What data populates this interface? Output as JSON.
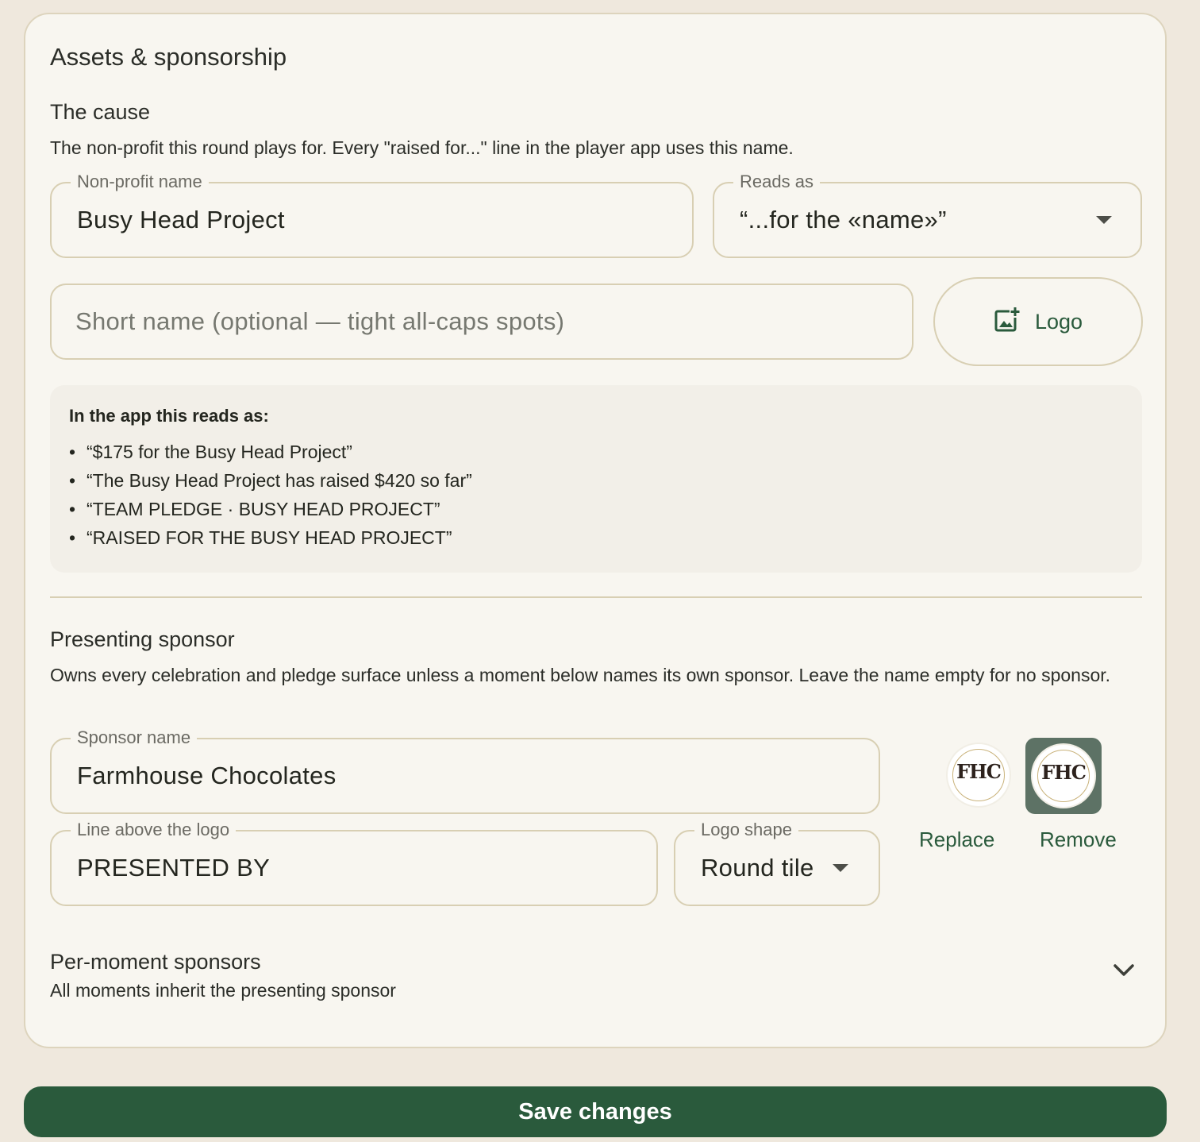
{
  "card": {
    "title": "Assets & sponsorship"
  },
  "cause": {
    "title": "The cause",
    "description": "The non-profit this round plays for. Every \"raised for...\" line in the player app uses this name.",
    "nonprofit_label": "Non-profit name",
    "nonprofit_value": "Busy Head Project",
    "reads_as_label": "Reads as",
    "reads_as_value": "“...for the «name»”",
    "short_name_placeholder": "Short name (optional — tight all-caps spots)",
    "logo_button_label": "Logo",
    "preview_heading": "In the app this reads as:",
    "preview_lines": [
      "“$175 for the Busy Head Project”",
      "“The Busy Head Project has raised $420 so far”",
      "“TEAM PLEDGE · BUSY HEAD PROJECT”",
      "“RAISED FOR THE BUSY HEAD PROJECT”"
    ]
  },
  "sponsor": {
    "title": "Presenting sponsor",
    "description": "Owns every celebration and pledge surface unless a moment below names its own sponsor. Leave the name empty for no sponsor.",
    "name_label": "Sponsor name",
    "name_value": "Farmhouse Chocolates",
    "line_label": "Line above the logo",
    "line_value": "PRESENTED BY",
    "shape_label": "Logo shape",
    "shape_value": "Round tile",
    "logo_text": "FHC",
    "replace_label": "Replace",
    "remove_label": "Remove"
  },
  "per_moment": {
    "title": "Per-moment sponsors",
    "subtitle": "All moments inherit the presenting sponsor"
  },
  "actions": {
    "save_label": "Save changes"
  },
  "colors": {
    "accent": "#2a5a3c",
    "background": "#efe8dd",
    "card": "#f8f6f0",
    "border": "#d8cfb3"
  },
  "icons": {
    "logo_button": "add-photo-icon",
    "select": "caret-down-icon",
    "collapse": "chevron-down-icon"
  }
}
